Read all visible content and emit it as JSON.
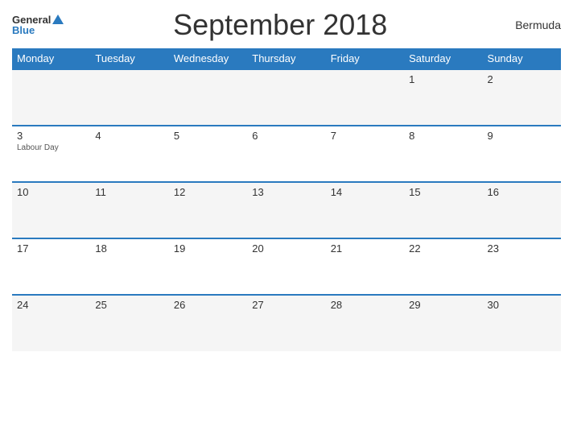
{
  "header": {
    "logo_general": "General",
    "logo_blue": "Blue",
    "title": "September 2018",
    "region": "Bermuda"
  },
  "weekdays": [
    "Monday",
    "Tuesday",
    "Wednesday",
    "Thursday",
    "Friday",
    "Saturday",
    "Sunday"
  ],
  "weeks": [
    [
      {
        "day": "",
        "holiday": ""
      },
      {
        "day": "",
        "holiday": ""
      },
      {
        "day": "",
        "holiday": ""
      },
      {
        "day": "",
        "holiday": ""
      },
      {
        "day": "",
        "holiday": ""
      },
      {
        "day": "1",
        "holiday": ""
      },
      {
        "day": "2",
        "holiday": ""
      }
    ],
    [
      {
        "day": "3",
        "holiday": "Labour Day"
      },
      {
        "day": "4",
        "holiday": ""
      },
      {
        "day": "5",
        "holiday": ""
      },
      {
        "day": "6",
        "holiday": ""
      },
      {
        "day": "7",
        "holiday": ""
      },
      {
        "day": "8",
        "holiday": ""
      },
      {
        "day": "9",
        "holiday": ""
      }
    ],
    [
      {
        "day": "10",
        "holiday": ""
      },
      {
        "day": "11",
        "holiday": ""
      },
      {
        "day": "12",
        "holiday": ""
      },
      {
        "day": "13",
        "holiday": ""
      },
      {
        "day": "14",
        "holiday": ""
      },
      {
        "day": "15",
        "holiday": ""
      },
      {
        "day": "16",
        "holiday": ""
      }
    ],
    [
      {
        "day": "17",
        "holiday": ""
      },
      {
        "day": "18",
        "holiday": ""
      },
      {
        "day": "19",
        "holiday": ""
      },
      {
        "day": "20",
        "holiday": ""
      },
      {
        "day": "21",
        "holiday": ""
      },
      {
        "day": "22",
        "holiday": ""
      },
      {
        "day": "23",
        "holiday": ""
      }
    ],
    [
      {
        "day": "24",
        "holiday": ""
      },
      {
        "day": "25",
        "holiday": ""
      },
      {
        "day": "26",
        "holiday": ""
      },
      {
        "day": "27",
        "holiday": ""
      },
      {
        "day": "28",
        "holiday": ""
      },
      {
        "day": "29",
        "holiday": ""
      },
      {
        "day": "30",
        "holiday": ""
      }
    ]
  ]
}
